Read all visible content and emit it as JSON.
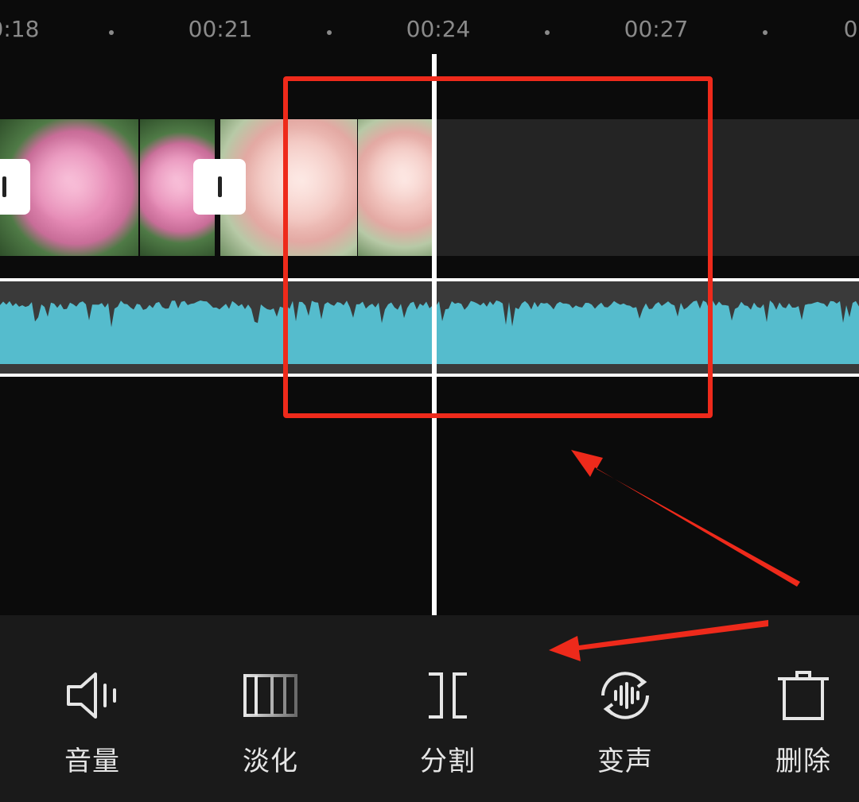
{
  "ruler": {
    "labels": [
      "0:18",
      "00:21",
      "00:24",
      "00:27",
      "0("
    ]
  },
  "toolbar": {
    "items": [
      {
        "label": "音量",
        "icon": "volume-icon"
      },
      {
        "label": "淡化",
        "icon": "fade-icon"
      },
      {
        "label": "分割",
        "icon": "split-icon"
      },
      {
        "label": "变声",
        "icon": "voice-change-icon"
      },
      {
        "label": "删除",
        "icon": "delete-icon"
      }
    ]
  },
  "colors": {
    "background": "#0b0b0b",
    "toolbar": "#1a1a1a",
    "waveform": "#55bccd",
    "annotation": "#ee2a1b",
    "playhead": "#ffffff"
  }
}
